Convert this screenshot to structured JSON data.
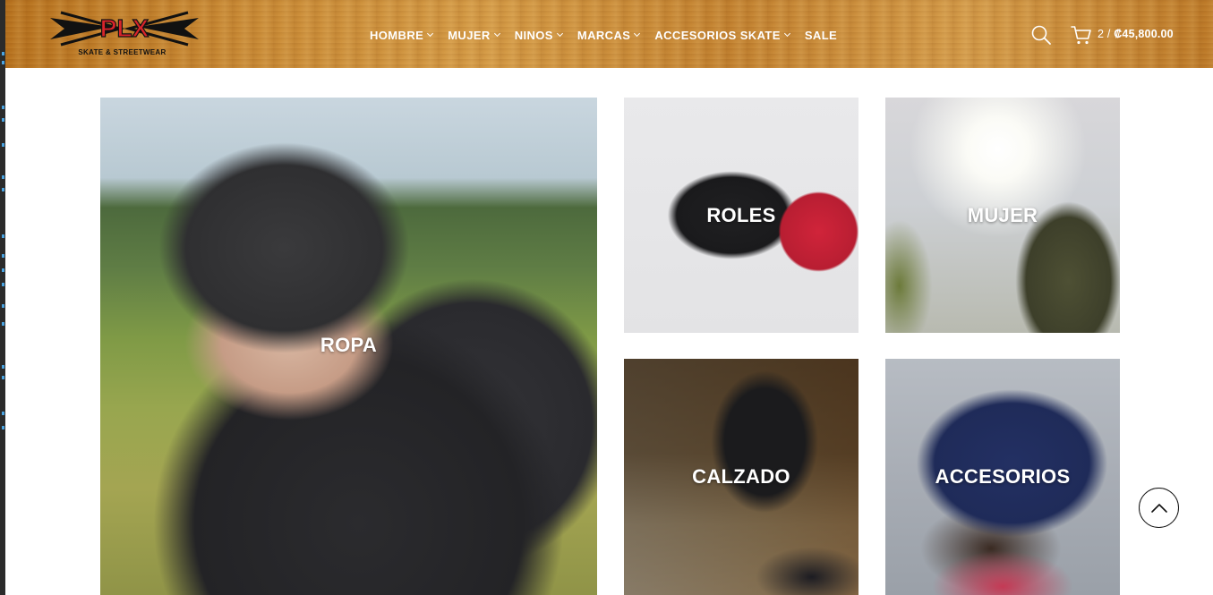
{
  "brand": {
    "logo_text": "PLX",
    "tagline": "SKATE & STREETWEAR",
    "logo_color": "#d8242b"
  },
  "nav": {
    "items": [
      {
        "label": "HOMBRE",
        "has_dropdown": true
      },
      {
        "label": "MUJER",
        "has_dropdown": true
      },
      {
        "label": "NINOS",
        "has_dropdown": true
      },
      {
        "label": "MARCAS",
        "has_dropdown": true
      },
      {
        "label": "ACCESORIOS SKATE",
        "has_dropdown": true
      },
      {
        "label": "SALE",
        "has_dropdown": false
      }
    ]
  },
  "header_icons": {
    "search": "search-icon",
    "cart": "cart-icon"
  },
  "cart": {
    "count": "2 /",
    "total": "₡45,800.00"
  },
  "categories": {
    "ropa": {
      "label": "ROPA"
    },
    "roles": {
      "label": "ROLES"
    },
    "mujer": {
      "label": "MUJER"
    },
    "calzado": {
      "label": "CALZADO"
    },
    "accesorios": {
      "label": "ACCESORIOS"
    }
  },
  "scroll_top": {
    "icon": "chevron-up-icon"
  },
  "colors": {
    "header_wood": "#c98a35",
    "nav_text": "#ffffff",
    "tile_label": "#ffffff"
  }
}
